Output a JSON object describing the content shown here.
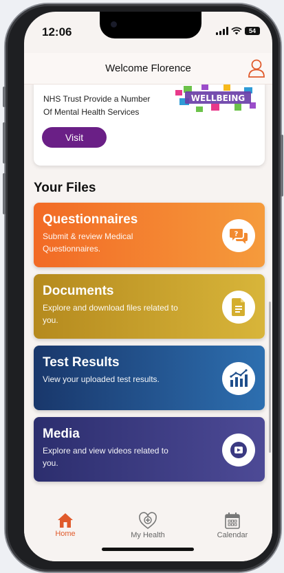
{
  "status": {
    "time": "12:06",
    "battery": "54"
  },
  "header": {
    "title": "Welcome Florence"
  },
  "promo": {
    "line1": "NHS Trust Provide a Number",
    "line2": "Of Mental Health Services",
    "visit_label": "Visit",
    "banner_text": "WELLBEING"
  },
  "files": {
    "section_title": "Your Files",
    "items": [
      {
        "title": "Questionnaires",
        "desc": "Submit & review Medical Questionnaires.",
        "icon": "chat-question-icon",
        "color": "#f26a25"
      },
      {
        "title": "Documents",
        "desc": "Explore and download files related to you.",
        "icon": "document-icon",
        "color": "#c9a02c"
      },
      {
        "title": "Test Results",
        "desc": "View your uploaded test results.",
        "icon": "bar-chart-icon",
        "color": "#1f4f8c"
      },
      {
        "title": "Media",
        "desc": "Explore and view videos related to you.",
        "icon": "play-icon",
        "color": "#3b3a82"
      }
    ]
  },
  "tabbar": {
    "home": "Home",
    "health": "My Health",
    "calendar": "Calendar",
    "active_color": "#e05a2b"
  }
}
